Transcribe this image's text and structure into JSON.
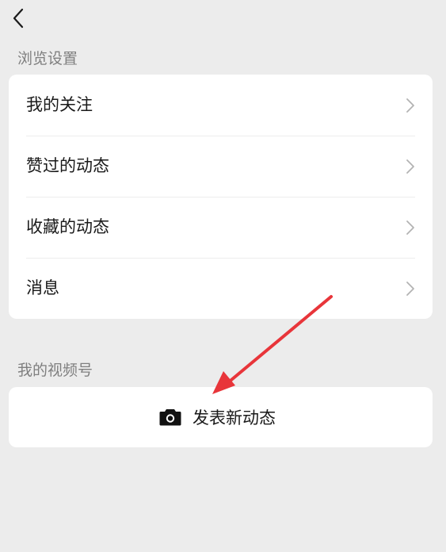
{
  "nav": {
    "back_icon": "chevron-left-icon"
  },
  "browse_section": {
    "title": "浏览设置",
    "items": [
      {
        "label": "我的关注",
        "icon": "chevron-right-icon"
      },
      {
        "label": "赞过的动态",
        "icon": "chevron-right-icon"
      },
      {
        "label": "收藏的动态",
        "icon": "chevron-right-icon"
      },
      {
        "label": "消息",
        "icon": "chevron-right-icon"
      }
    ]
  },
  "channel_section": {
    "title": "我的视频号",
    "post_button": {
      "label": "发表新动态",
      "icon": "camera-icon"
    }
  },
  "colors": {
    "background": "#ececec",
    "card": "#ffffff",
    "annotation_arrow": "#e8353a",
    "secondary_text": "#7f7f7f"
  }
}
